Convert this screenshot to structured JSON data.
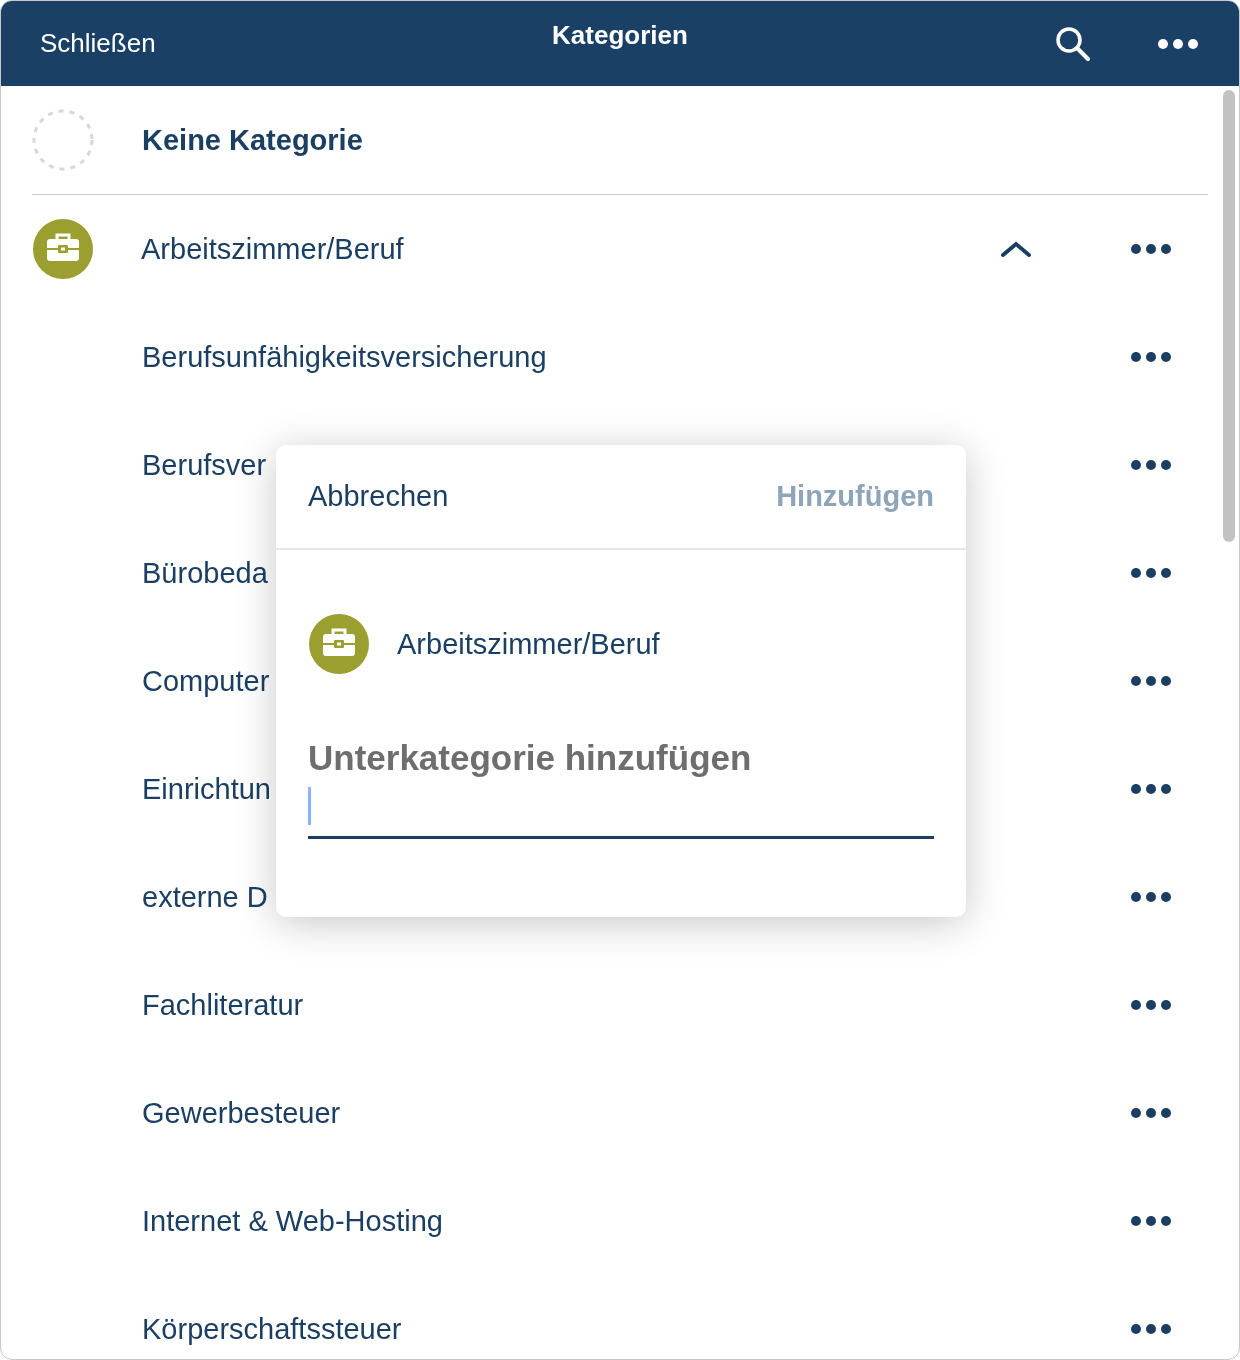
{
  "header": {
    "close": "Schließen",
    "title": "Kategorien"
  },
  "no_category": {
    "label": "Keine Kategorie"
  },
  "categories": [
    {
      "label": "Arbeitszimmer/Beruf",
      "expanded": true,
      "children": [
        {
          "label": "Berufsunfähigkeitsversicherung"
        },
        {
          "label": "Berufsver"
        },
        {
          "label": "Bürobeda"
        },
        {
          "label": "Computer"
        },
        {
          "label": "Einrichtun"
        },
        {
          "label": "externe D"
        },
        {
          "label": "Fachliteratur"
        },
        {
          "label": "Gewerbesteuer"
        },
        {
          "label": "Internet & Web-Hosting"
        },
        {
          "label": "Körperschaftssteuer"
        }
      ]
    }
  ],
  "dialog": {
    "cancel": "Abbrechen",
    "confirm": {
      "label": "Hinzufügen",
      "disabled": true
    },
    "parent": {
      "label": "Arbeitszimmer/Beruf"
    },
    "field": {
      "placeholder": "Unterkategorie hinzufügen"
    }
  }
}
